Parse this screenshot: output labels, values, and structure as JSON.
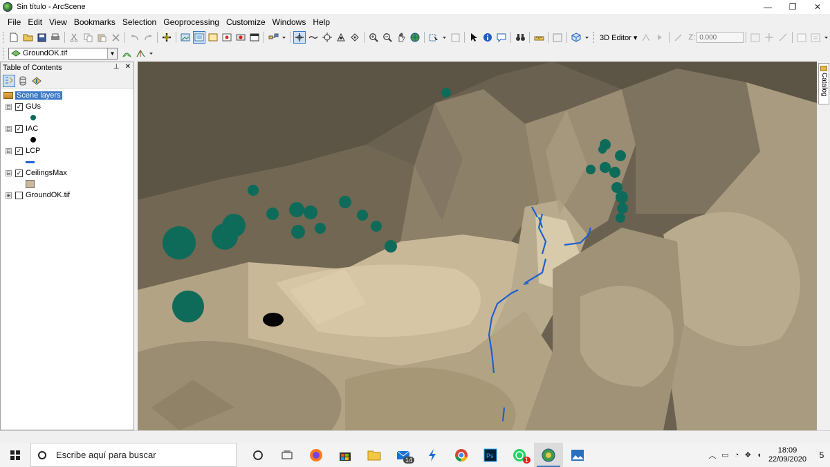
{
  "window": {
    "title": "Sin título - ArcScene",
    "min_glyph": "—",
    "max_glyph": "❐",
    "close_glyph": "✕"
  },
  "menu": [
    "File",
    "Edit",
    "View",
    "Bookmarks",
    "Selection",
    "Geoprocessing",
    "Customize",
    "Windows",
    "Help"
  ],
  "toolbar": {
    "editor_label": "3D Editor ▾",
    "z_label": "Z:",
    "z_value": "0.000",
    "layer_select_value": "GroundOK.tif"
  },
  "toc": {
    "title": "Table of Contents",
    "root_label": "Scene layers",
    "layers": [
      {
        "name": "GUs",
        "checked": true,
        "expander": "⊟",
        "symbol": "dot",
        "color": "#0e6b5a"
      },
      {
        "name": "IAC",
        "checked": true,
        "expander": "⊟",
        "symbol": "dot",
        "color": "#000000"
      },
      {
        "name": "LCP",
        "checked": true,
        "expander": "⊟",
        "symbol": "line",
        "color": "#1e5fd1"
      },
      {
        "name": "CeilingsMax",
        "checked": true,
        "expander": "⊟",
        "symbol": "fill",
        "color": "#c9b89a"
      },
      {
        "name": "GroundOK.tif",
        "checked": false,
        "expander": "⊞",
        "symbol": "none",
        "color": ""
      }
    ]
  },
  "catalog_tab": "Catalog",
  "taskbar": {
    "search_placeholder": "Escribe aquí para buscar",
    "mail_badge": "14",
    "whatsapp_badge": "1",
    "time": "18:09",
    "date": "22/09/2020",
    "notification_count": "5"
  },
  "colors": {
    "gus_sphere": "#0e6b5a",
    "terrain": "#a89c84",
    "lcp_line": "#1e5fd1"
  }
}
